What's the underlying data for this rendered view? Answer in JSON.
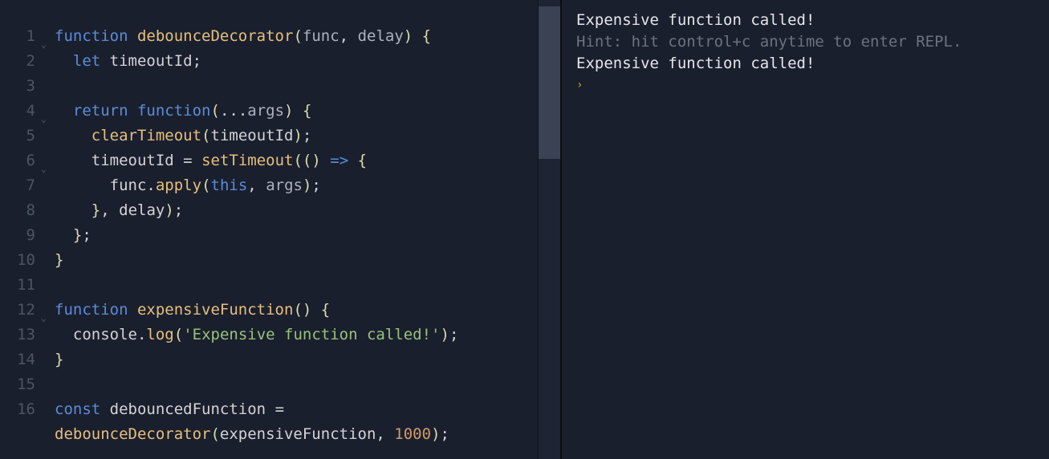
{
  "editor": {
    "lines": [
      {
        "num": "1",
        "fold": true
      },
      {
        "num": "2",
        "fold": false
      },
      {
        "num": "3",
        "fold": false
      },
      {
        "num": "4",
        "fold": true
      },
      {
        "num": "5",
        "fold": false
      },
      {
        "num": "6",
        "fold": true
      },
      {
        "num": "7",
        "fold": false
      },
      {
        "num": "8",
        "fold": false
      },
      {
        "num": "9",
        "fold": false
      },
      {
        "num": "10",
        "fold": false
      },
      {
        "num": "11",
        "fold": false
      },
      {
        "num": "12",
        "fold": true
      },
      {
        "num": "13",
        "fold": false
      },
      {
        "num": "14",
        "fold": false
      },
      {
        "num": "15",
        "fold": false
      },
      {
        "num": "16",
        "fold": false
      }
    ],
    "tokens": {
      "l1": {
        "kw1": "function",
        "fn": "debounceDecorator",
        "p1": "(",
        "param1": "func",
        "c1": ",",
        "sp": " ",
        "param2": "delay",
        "p2": ")",
        "sp2": " ",
        "b1": "{"
      },
      "l2": {
        "ind": "  ",
        "kw": "let",
        "sp": " ",
        "id": "timeoutId",
        "sc": ";"
      },
      "l3": {
        "blank": ""
      },
      "l4": {
        "ind": "  ",
        "kw": "return",
        "sp": " ",
        "fn": "function",
        "p1": "(",
        "spread": "...",
        "param": "args",
        "p2": ")",
        "sp2": " ",
        "b": "{"
      },
      "l5": {
        "ind": "    ",
        "fn": "clearTimeout",
        "p1": "(",
        "id": "timeoutId",
        "p2": ")",
        "sc": ";"
      },
      "l6": {
        "ind": "    ",
        "id1": "timeoutId",
        "sp": " ",
        "op": "=",
        "sp2": " ",
        "fn": "setTimeout",
        "p1": "(",
        "p2": "(",
        "p3": ")",
        "sp3": " ",
        "arrow": "=>",
        "sp4": " ",
        "b": "{"
      },
      "l7": {
        "ind": "      ",
        "id": "func",
        "dot": ".",
        "method": "apply",
        "p1": "(",
        "this": "this",
        "c": ",",
        "sp": " ",
        "param": "args",
        "p2": ")",
        "sc": ";"
      },
      "l8": {
        "ind": "    ",
        "b": "}",
        "c": ",",
        "sp": " ",
        "id": "delay",
        "p": ")",
        "sc": ";"
      },
      "l9": {
        "ind": "  ",
        "b": "}",
        "sc": ";"
      },
      "l10": {
        "b": "}"
      },
      "l11": {
        "blank": ""
      },
      "l12": {
        "kw": "function",
        "sp": " ",
        "fn": "expensiveFunction",
        "p1": "(",
        "p2": ")",
        "sp2": " ",
        "b": "{"
      },
      "l13": {
        "ind": "  ",
        "obj": "console",
        "dot": ".",
        "method": "log",
        "p1": "(",
        "str": "'Expensive function called!'",
        "p2": ")",
        "sc": ";"
      },
      "l14": {
        "b": "}"
      },
      "l15": {
        "blank": ""
      },
      "l16": {
        "kw": "const",
        "sp": " ",
        "id": "debouncedFunction",
        "sp2": " ",
        "op": "="
      },
      "l17": {
        "fn": "debounceDecorator",
        "p1": "(",
        "id": "expensiveFunction",
        "c": ",",
        "sp": " ",
        "num": "1000",
        "p2": ")",
        "sc": ";"
      }
    }
  },
  "output": {
    "line1": "Expensive function called!",
    "line2": "Hint: hit control+c anytime to enter REPL.",
    "line3": "Expensive function called!",
    "prompt": "›"
  }
}
